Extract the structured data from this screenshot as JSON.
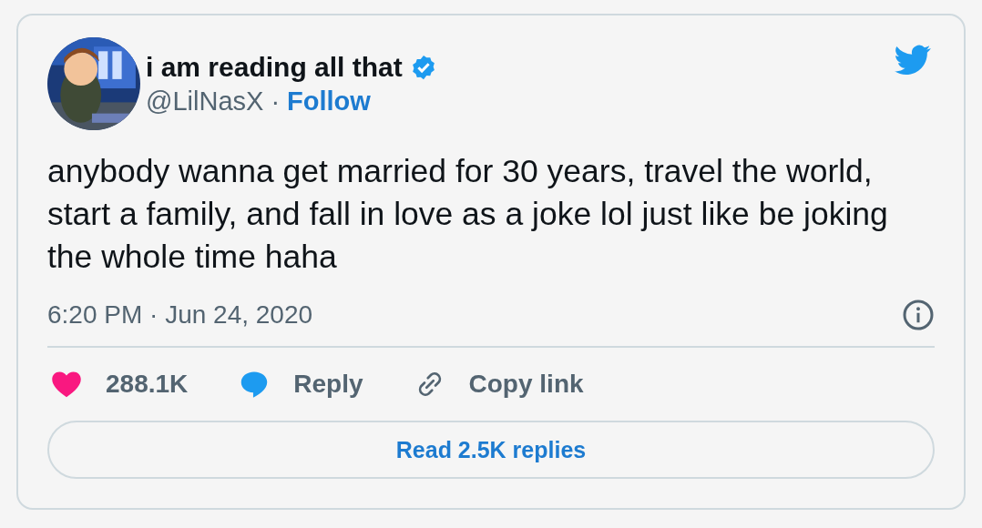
{
  "author": {
    "name": "i am reading all that",
    "verified": true,
    "handle": "@LilNasX",
    "separator": "·",
    "follow": "Follow"
  },
  "text": "anybody wanna get married for 30 years, travel the world, start a family, and fall in love as a joke lol just like be joking the whole time haha",
  "timestamp": "6:20 PM · Jun 24, 2020",
  "actions": [
    {
      "kind": "like",
      "label": "288.1K"
    },
    {
      "kind": "reply",
      "label": "Reply"
    },
    {
      "kind": "copy",
      "label": "Copy link"
    }
  ],
  "read_replies": "Read 2.5K replies"
}
